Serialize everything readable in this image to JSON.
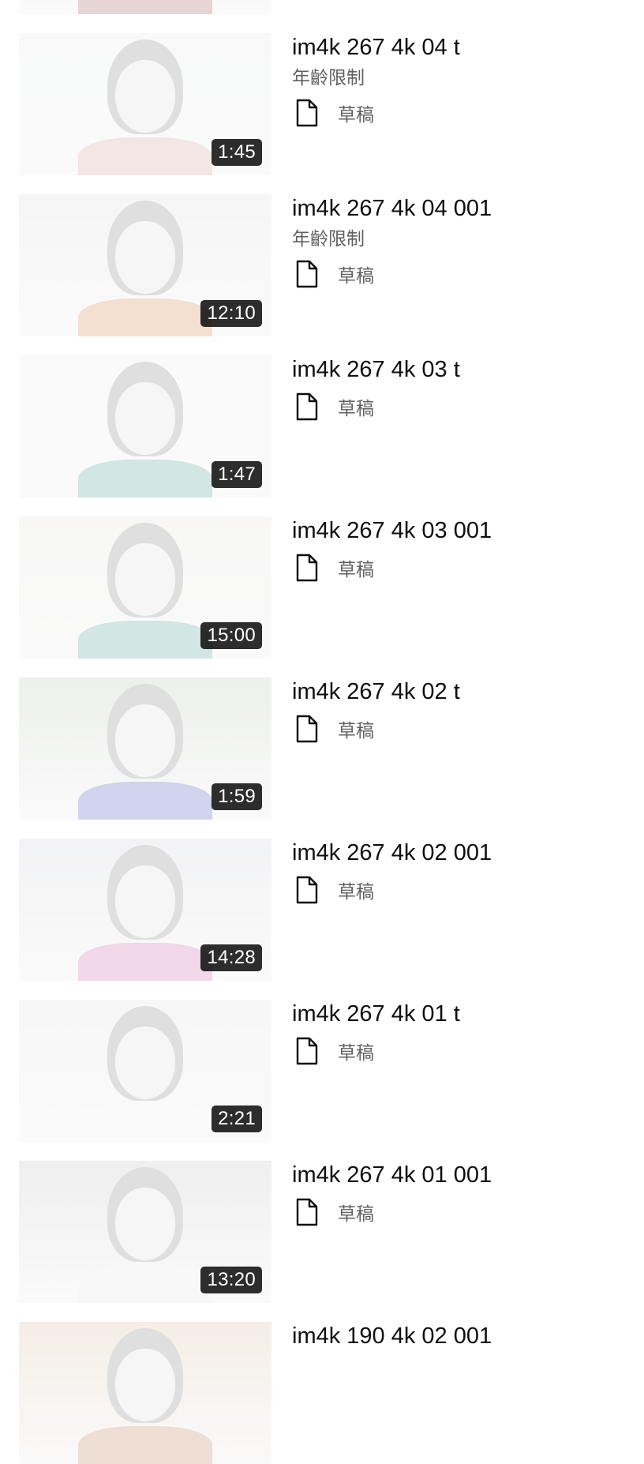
{
  "videos": [
    {
      "title": "",
      "age_label": "",
      "status": "",
      "duration": "",
      "palette": {
        "bg": "#dcdcdc",
        "body": "#c9a0a0"
      }
    },
    {
      "title": "im4k 267 4k 04 t",
      "age_label": "年齡限制",
      "status": "草稿",
      "duration": "1:45",
      "palette": {
        "bg": "#f1f2f4",
        "body": "#e5c7c4"
      }
    },
    {
      "title": "im4k 267 4k 04 001",
      "age_label": "年齡限制",
      "status": "草稿",
      "duration": "12:10",
      "palette": {
        "bg": "#ebebeb",
        "body": "#e8b89a"
      }
    },
    {
      "title": "im4k 267 4k 03 t",
      "age_label": "",
      "status": "草稿",
      "duration": "1:47",
      "palette": {
        "bg": "#f3f3f3",
        "body": "#9cc8c0"
      }
    },
    {
      "title": "im4k 267 4k 03 001",
      "age_label": "",
      "status": "草稿",
      "duration": "15:00",
      "palette": {
        "bg": "#efeeec",
        "body": "#9cc8c0"
      }
    },
    {
      "title": "im4k 267 4k 02 t",
      "age_label": "",
      "status": "草稿",
      "duration": "1:59",
      "palette": {
        "bg": "#d7ddd6",
        "body": "#9aa0d6"
      }
    },
    {
      "title": "im4k 267 4k 02 001",
      "age_label": "",
      "status": "草稿",
      "duration": "14:28",
      "palette": {
        "bg": "#e3e4e7",
        "body": "#dfa6c9"
      }
    },
    {
      "title": "im4k 267 4k 01 t",
      "age_label": "",
      "status": "草稿",
      "duration": "2:21",
      "palette": {
        "bg": "#ededed",
        "body": "#f4f4f4"
      }
    },
    {
      "title": "im4k 267 4k 01 001",
      "age_label": "",
      "status": "草稿",
      "duration": "13:20",
      "palette": {
        "bg": "#dcdcdc",
        "body": "#efefef"
      }
    },
    {
      "title": "im4k 190 4k 02 001",
      "age_label": "",
      "status": "",
      "duration": "",
      "palette": {
        "bg": "#e8d8c8",
        "body": "#d9b7a0"
      }
    }
  ],
  "icons": {
    "status": "document-outline-icon"
  }
}
